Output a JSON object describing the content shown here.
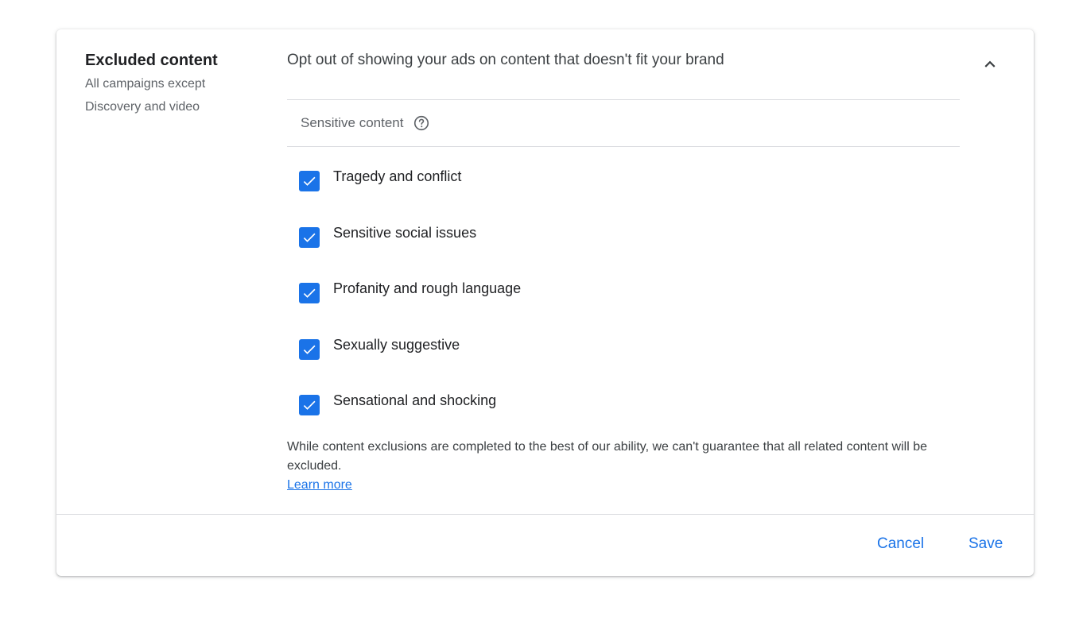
{
  "section": {
    "title": "Excluded content",
    "subtitle": "All campaigns except\nDiscovery and video",
    "description": "Opt out of showing your ads on content that doesn't fit your brand"
  },
  "sensitive": {
    "label": "Sensitive content",
    "options": [
      {
        "label": "Tragedy and conflict",
        "checked": true
      },
      {
        "label": "Sensitive social issues",
        "checked": true
      },
      {
        "label": "Profanity and rough language",
        "checked": true
      },
      {
        "label": "Sexually suggestive",
        "checked": true
      },
      {
        "label": "Sensational and shocking",
        "checked": true
      }
    ]
  },
  "disclaimer": {
    "text": "While content exclusions are completed to the best of our ability, we can't guarantee that all related content will be excluded.",
    "link": "Learn more"
  },
  "footer": {
    "cancel_label": "Cancel",
    "save_label": "Save"
  },
  "colors": {
    "accent": "#1a73e8",
    "divider": "#dadce0"
  },
  "icons": {
    "collapse": "chevron-up-icon",
    "help": "help-circle-icon",
    "check": "check-icon"
  }
}
